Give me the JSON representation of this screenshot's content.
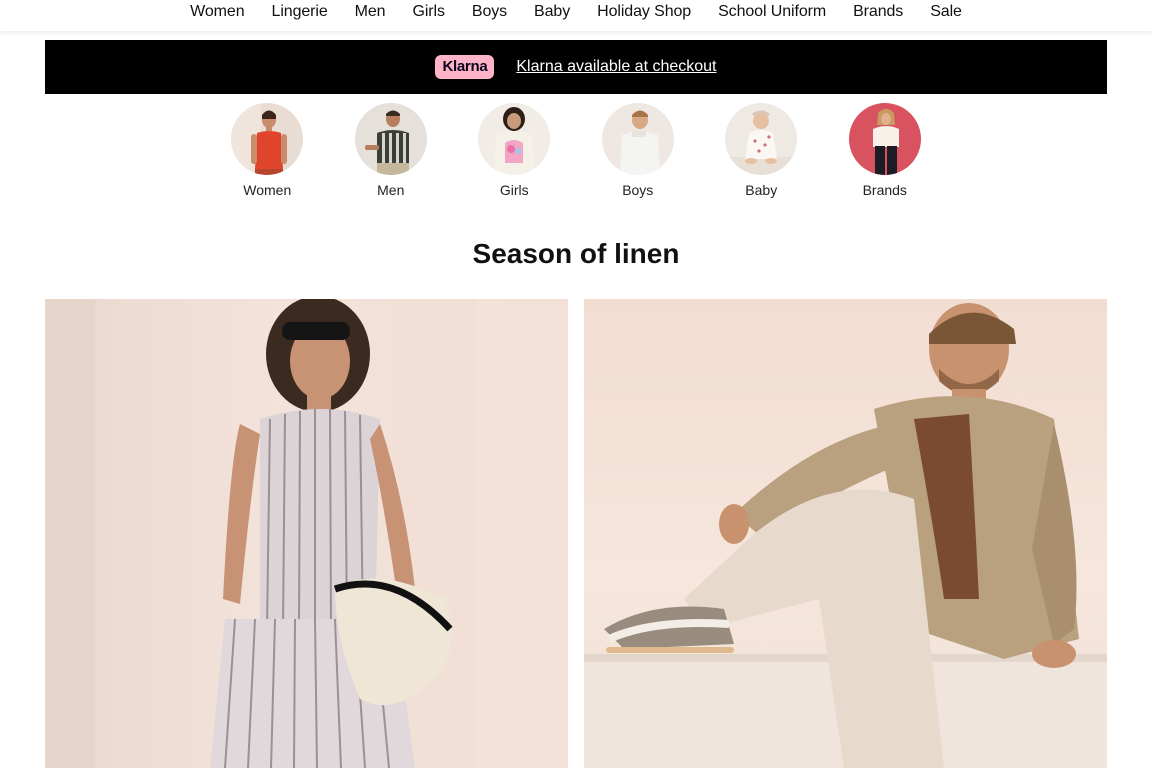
{
  "nav": {
    "items": [
      "Women",
      "Lingerie",
      "Men",
      "Girls",
      "Boys",
      "Baby",
      "Holiday Shop",
      "School Uniform",
      "Brands",
      "Sale"
    ]
  },
  "banner": {
    "badge": "Klarna",
    "link_text": "Klarna available at checkout"
  },
  "categories": [
    {
      "label": "Women"
    },
    {
      "label": "Men"
    },
    {
      "label": "Girls"
    },
    {
      "label": "Boys"
    },
    {
      "label": "Baby"
    },
    {
      "label": "Brands"
    }
  ],
  "section": {
    "title": "Season of linen"
  },
  "colors": {
    "banner_bg": "#000000",
    "klarna_pink": "#ffb3c7"
  }
}
